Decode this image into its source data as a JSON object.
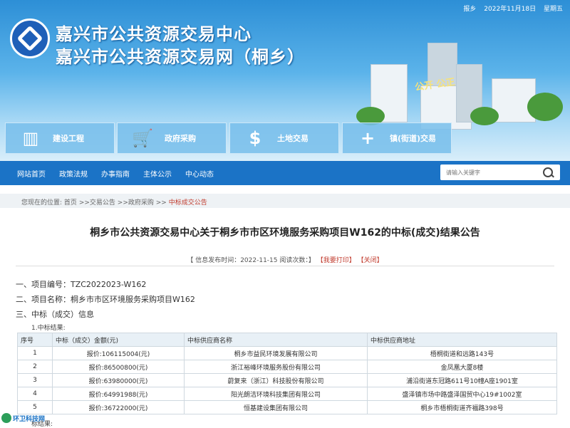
{
  "topbar": {
    "home": "报乡",
    "date": "2022年11月18日",
    "weekday": "星期五"
  },
  "site": {
    "title_line1": "嘉兴市公共资源交易中心",
    "title_line2": "嘉兴市公共资源交易网（桐乡）",
    "slogan": "公开  公正"
  },
  "categories": [
    {
      "label": "建设工程",
      "icon": "building-icon"
    },
    {
      "label": "政府采购",
      "icon": "cart-icon"
    },
    {
      "label": "土地交易",
      "icon": "dollar-icon"
    },
    {
      "label": "镇(街道)交易",
      "icon": "plus-icon"
    }
  ],
  "nav": {
    "items": [
      "网站首页",
      "政策法规",
      "办事指南",
      "主体公示",
      "中心动态"
    ]
  },
  "search": {
    "placeholder": "请输入关键字"
  },
  "breadcrumb": {
    "prefix": "您现在的位置:",
    "home": "首页",
    "l1": ">>交易公告",
    "l2": ">>政府采购",
    "l3": ">>",
    "current": "中标成交公告"
  },
  "article": {
    "title": "桐乡市公共资源交易中心关于桐乡市市区环境服务采购项目W162的中标(成交)结果公告",
    "meta_left": "【 信息发布时间：2022-11-15  阅读次数：",
    "meta_close": "】",
    "print": "【我要打印】",
    "close": "【关闭】",
    "sec1": "一、项目编号：TZC2022023-W162",
    "sec2": "二、项目名称：桐乡市市区环境服务采购项目W162",
    "sec3": "三、中标（成交）信息",
    "sub1": "1.中标结果:",
    "sub2": "标结果:"
  },
  "table": {
    "headers": [
      "序号",
      "中标（成交）金额(元)",
      "中标供应商名称",
      "中标供应商地址"
    ],
    "rows": [
      [
        "1",
        "报价:106115004(元)",
        "桐乡市益民环境发展有限公司",
        "梧桐街道和远路143号"
      ],
      [
        "2",
        "报价:86500800(元)",
        "浙江裕峰环境服务股份有限公司",
        "金凤凰大厦8楼"
      ],
      [
        "3",
        "报价:63980000(元)",
        "蔚复来（浙江）科技股份有限公司",
        "浦沿街道东冠路611号10幢A座1901室"
      ],
      [
        "4",
        "报价:64991988(元)",
        "阳光朗洁环境科技集团有限公司",
        "盛泽镇市场中路盛泽国贸中心19#1002室"
      ],
      [
        "5",
        "报价:36722000(元)",
        "恒基建设集团有限公司",
        "桐乡市梧桐街道齐福路398号"
      ]
    ]
  },
  "watermark": "环卫科技网"
}
